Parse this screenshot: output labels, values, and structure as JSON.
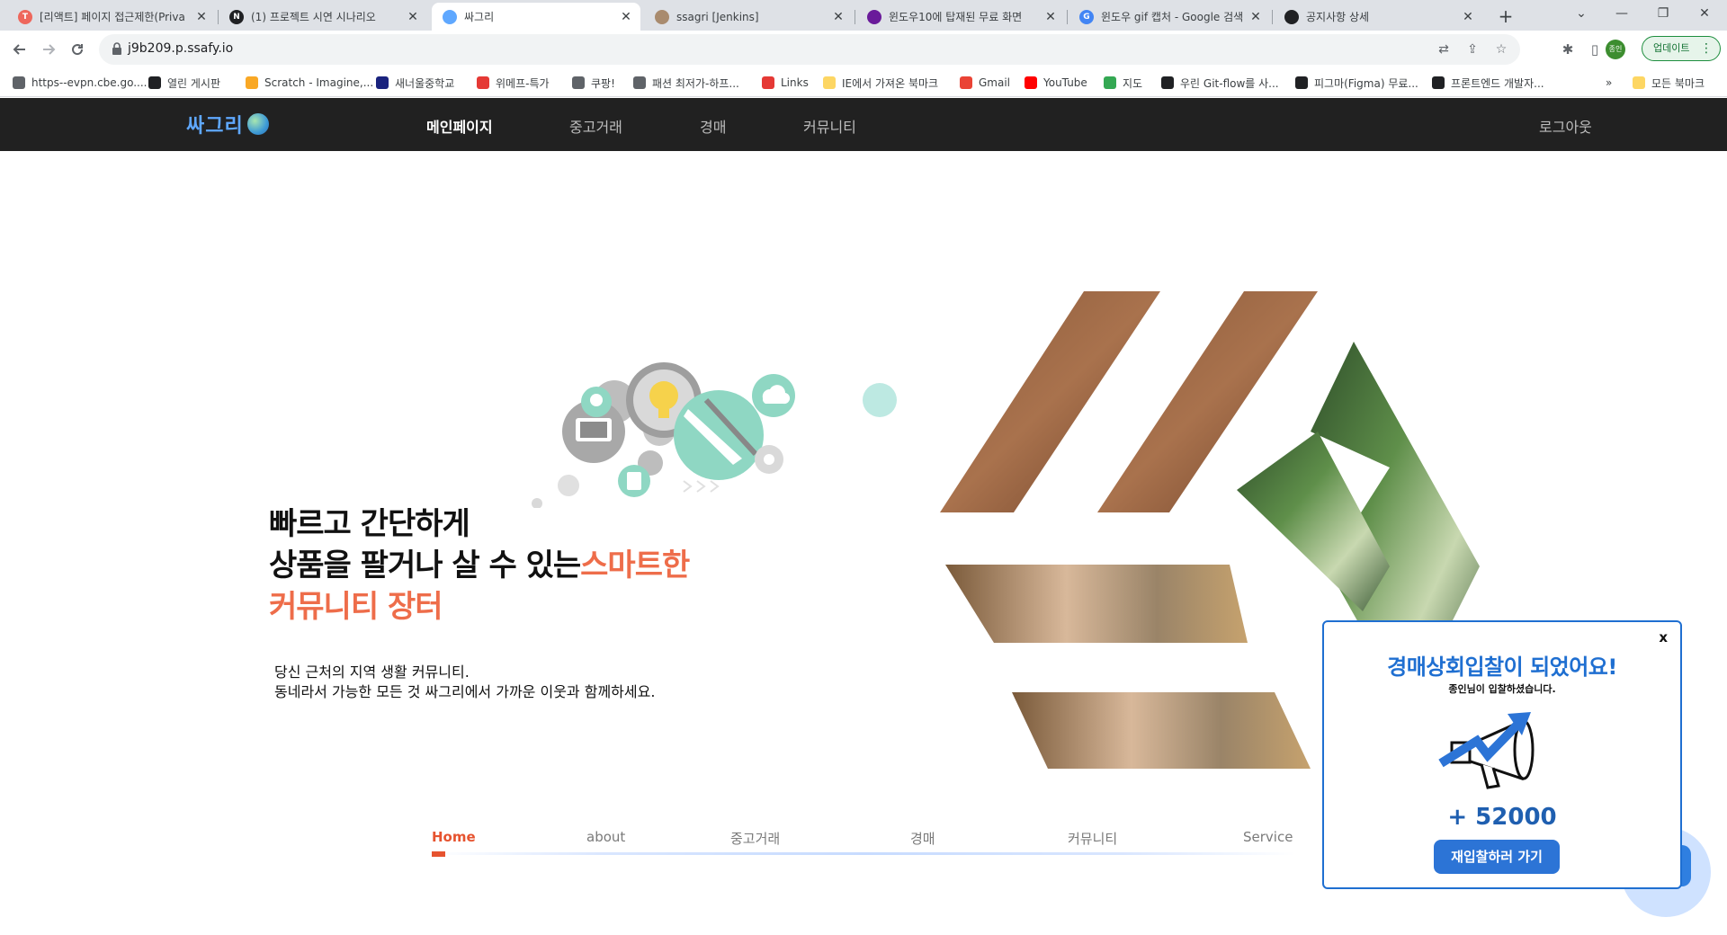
{
  "browser": {
    "tabs": [
      {
        "title": "[리액트] 페이지 접근제한(Priva",
        "favicon_color": "#ee675c",
        "favicon_glyph": "T",
        "active": false
      },
      {
        "title": "(1) 프로젝트 시연 시나리오",
        "favicon_color": "#202124",
        "favicon_glyph": "N",
        "active": false
      },
      {
        "title": "싸그리",
        "favicon_color": "#5fa8ff",
        "favicon_glyph": "",
        "active": true
      },
      {
        "title": "ssagri [Jenkins]",
        "favicon_color": "#a98b6e",
        "favicon_glyph": "",
        "active": false
      },
      {
        "title": "윈도우10에 탑재된 무료 화면",
        "favicon_color": "#6a1b9a",
        "favicon_glyph": "",
        "active": false
      },
      {
        "title": "윈도우 gif 캡처 - Google 검색",
        "favicon_color": "#4285f4",
        "favicon_glyph": "G",
        "active": false
      },
      {
        "title": "공지사항 상세",
        "favicon_color": "#202124",
        "favicon_glyph": "",
        "active": false
      }
    ],
    "tab_close_glyph": "✕",
    "new_tab_glyph": "+",
    "window_controls": {
      "tab_search": "⌄",
      "minimize": "—",
      "restore": "❐",
      "close": "✕"
    },
    "url": "j9b209.p.ssafy.io",
    "profile_label": "종인",
    "update_label": "업데이트",
    "icons": [
      "back-icon",
      "forward-icon",
      "reload-icon",
      "lock-icon",
      "translate-icon",
      "share-icon",
      "star-icon",
      "extensions-icon",
      "sidepanel-icon",
      "menu-icon"
    ]
  },
  "bookmarks": [
    {
      "label": "https--evpn.cbe.go....",
      "color": "#5f6368"
    },
    {
      "label": "열린 게시판",
      "color": "#202124"
    },
    {
      "label": "Scratch - Imagine,...",
      "color": "#f9a825"
    },
    {
      "label": "새너울중학교",
      "color": "#1a237e"
    },
    {
      "label": "위메프-특가",
      "color": "#e53935"
    },
    {
      "label": "쿠팡!",
      "color": "#5f6368"
    },
    {
      "label": "패션 최저가-하프...",
      "color": "#5f6368"
    },
    {
      "label": "Links",
      "color": "#e53935"
    },
    {
      "label": "IE에서 가져온 북마크",
      "color": "#fdd663"
    },
    {
      "label": "Gmail",
      "color": "#ea4335"
    },
    {
      "label": "YouTube",
      "color": "#ff0000"
    },
    {
      "label": "지도",
      "color": "#34a853"
    },
    {
      "label": "우린 Git-flow를 사...",
      "color": "#202124"
    },
    {
      "label": "피그마(Figma) 무료...",
      "color": "#202124"
    },
    {
      "label": "프론트엔드 개발자...",
      "color": "#202124"
    }
  ],
  "bookmarks_overflow": "»",
  "bookmarks_folder": "모든 북마크",
  "site": {
    "logo": "싸그리",
    "nav": [
      "메인페이지",
      "중고거래",
      "경매",
      "커뮤니티"
    ],
    "nav_active_index": 0,
    "logout": "로그아웃"
  },
  "hero": {
    "line1": "빠르고 간단하게",
    "line2_plain": "상품을 팔거나 살 수 있는",
    "line2_accent": "스마트한",
    "line3_accent": "커뮤니티 장터",
    "sub1": "당신 근처의 지역 생활 커뮤니티.",
    "sub2": "동네라서 가능한 모든 것 싸그리에서 가까운 이웃과 함께하세요."
  },
  "subnav": {
    "items": [
      "Home",
      "about",
      "중고거래",
      "경매",
      "커뮤니티",
      "Service"
    ],
    "active_index": 0
  },
  "popup": {
    "close": "x",
    "title": "경매상회입찰이 되었어요!",
    "subtitle": "종인님이 입찰하셨습니다.",
    "amount": "+ 52000",
    "button": "재입찰하러 가기",
    "icon": "megaphone-icon"
  },
  "colors": {
    "accent_orange": "#ee6d4a",
    "nav_bg": "#212121",
    "popup_blue": "#1f6fd1",
    "button_blue": "#2c74d6"
  }
}
